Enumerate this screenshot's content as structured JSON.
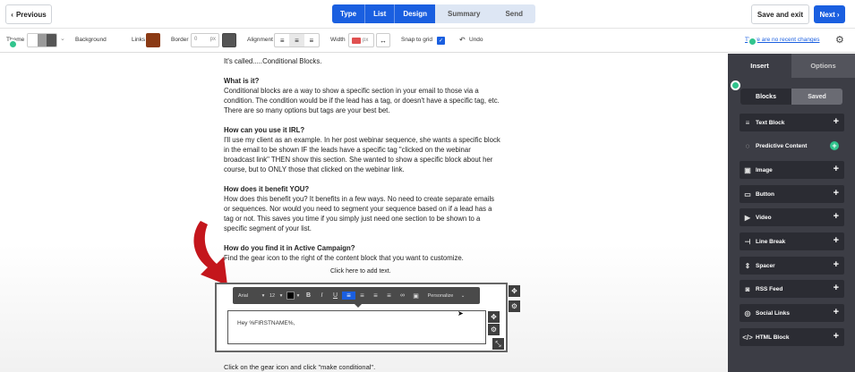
{
  "header": {
    "previous_label": "Previous",
    "steps": [
      "Type",
      "List",
      "Design",
      "Summary",
      "Send"
    ],
    "save_exit_label": "Save and exit",
    "next_label": "Next"
  },
  "toolbar": {
    "theme_label": "Theme",
    "background_label": "Background",
    "links_label": "Links",
    "links_color": "#8b3a14",
    "border_label": "Border",
    "border_value": "0",
    "border_unit": "px",
    "alignment_label": "Alignment",
    "width_label": "Width",
    "width_unit": "px",
    "snap_label": "Snap to grid",
    "undo_label": "Undo",
    "recent_changes_label": "There are no recent changes"
  },
  "content": {
    "intro": "It's called.....Conditional Blocks.",
    "h1": "What is it?",
    "p1": "Conditional blocks are a way to show a specific section in your email to those via a condition. The condition would be if the lead has a tag, or doesn't have a specific tag, etc. There are so many options but tags are your best bet.",
    "h2": "How can you use it IRL?",
    "p2": "I'll use my client as an example. In her post webinar sequence, she wants a specific block in the email to be shown IF the leads have a specific tag \"clicked on the webinar broadcast link\" THEN show this section. She wanted to show a specific block about her course, but to ONLY those that clicked on the webinar link.",
    "h3": "How does it benefit YOU?",
    "p3": "How does this benefit you? It benefits in a few ways. No need to create separate emails or sequences. Nor would you need to segment your sequence based on if a lead has a tag or not. This saves you time if you simply just need one section to be shown to a specific segment of your list.",
    "h4": "How do you find it in Active Campaign?",
    "p4": "Find the gear icon to the right of the content block that you want to customize.",
    "click_here": "Click here to add text.",
    "editor_text": "Hey %FIRSTNAME%,",
    "bottom": "Click on the gear icon and click \"make conditional\"."
  },
  "format_bar": {
    "font": "Arial",
    "size": "12",
    "personalize": "Personalize"
  },
  "panel": {
    "tab_insert": "Insert",
    "tab_options": "Options",
    "sub_blocks": "Blocks",
    "sub_saved": "Saved",
    "items": [
      {
        "label": "Text Block",
        "icon": "text-lines-icon"
      },
      {
        "label": "Predictive Content",
        "icon": "predictive-icon"
      },
      {
        "label": "Image",
        "icon": "image-icon"
      },
      {
        "label": "Button",
        "icon": "button-icon"
      },
      {
        "label": "Video",
        "icon": "play-icon"
      },
      {
        "label": "Line Break",
        "icon": "line-break-icon"
      },
      {
        "label": "Spacer",
        "icon": "spacer-icon"
      },
      {
        "label": "RSS Feed",
        "icon": "rss-icon"
      },
      {
        "label": "Social Links",
        "icon": "social-icon"
      },
      {
        "label": "HTML Block",
        "icon": "code-icon"
      }
    ]
  },
  "colors": {
    "accent": "#1a5fe0",
    "panel_bg": "#3c3d45",
    "marker_green": "#31c48d",
    "arrow_red": "#c4161c"
  }
}
